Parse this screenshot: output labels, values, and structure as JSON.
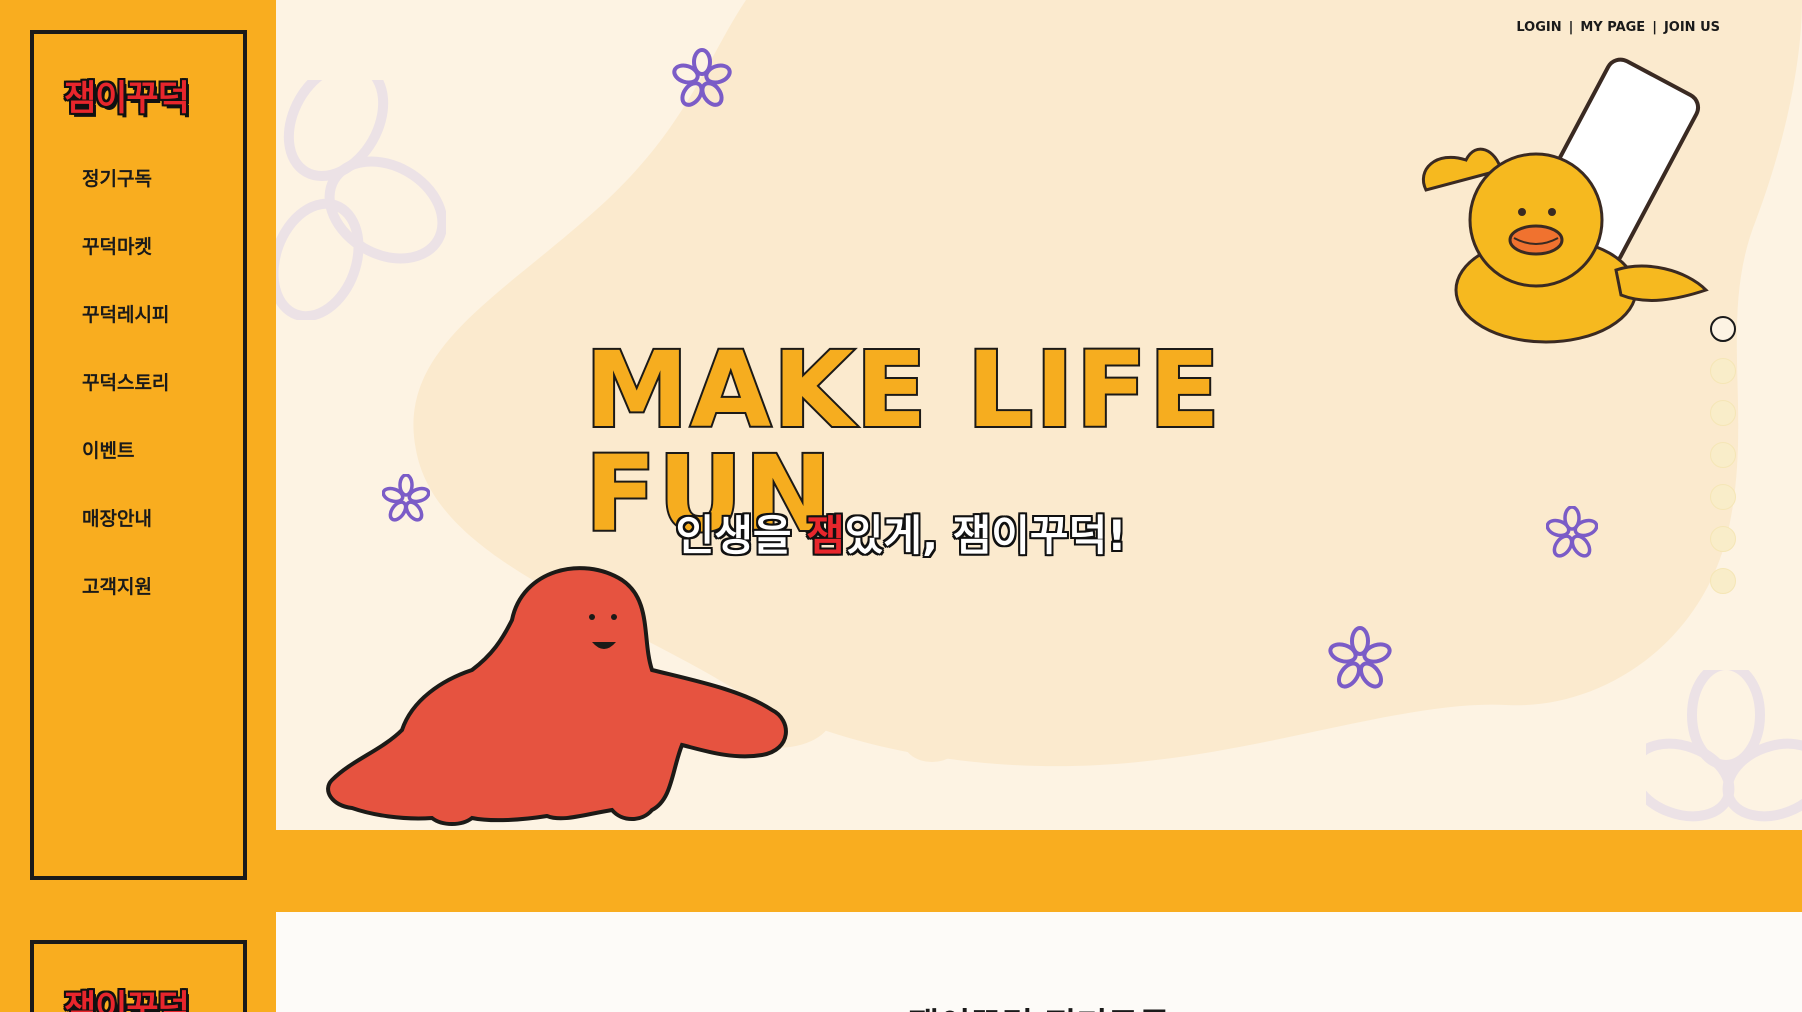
{
  "brand": {
    "logo": "잼이꾸덕"
  },
  "nav": [
    {
      "label": "정기구독"
    },
    {
      "label": "꾸덕마켓"
    },
    {
      "label": "꾸덕레시피"
    },
    {
      "label": "꾸덕스토리"
    },
    {
      "label": "이벤트"
    },
    {
      "label": "매장안내"
    },
    {
      "label": "고객지원"
    }
  ],
  "top_links": {
    "login": "LOGIN",
    "sep": "|",
    "mypage": "MY PAGE",
    "join": "JOIN US"
  },
  "hero": {
    "headline": "MAKE LIFE FUN",
    "sub_before": "인생을 ",
    "sub_accent": "잼",
    "sub_after": "있게, 잼이꾸덕!"
  },
  "slider": {
    "count": 7,
    "active_index": 0
  },
  "section": {
    "title": "잼이꾸덕 정기구독"
  },
  "colors": {
    "accent_orange": "#f9ad1f",
    "accent_red": "#e8262c",
    "jam_red": "#e65340",
    "flower_purple": "#7b5cc7",
    "cream": "#fdf3e3"
  },
  "icons": [
    "flower-icon",
    "duck-illustration",
    "jam-blob-illustration"
  ]
}
